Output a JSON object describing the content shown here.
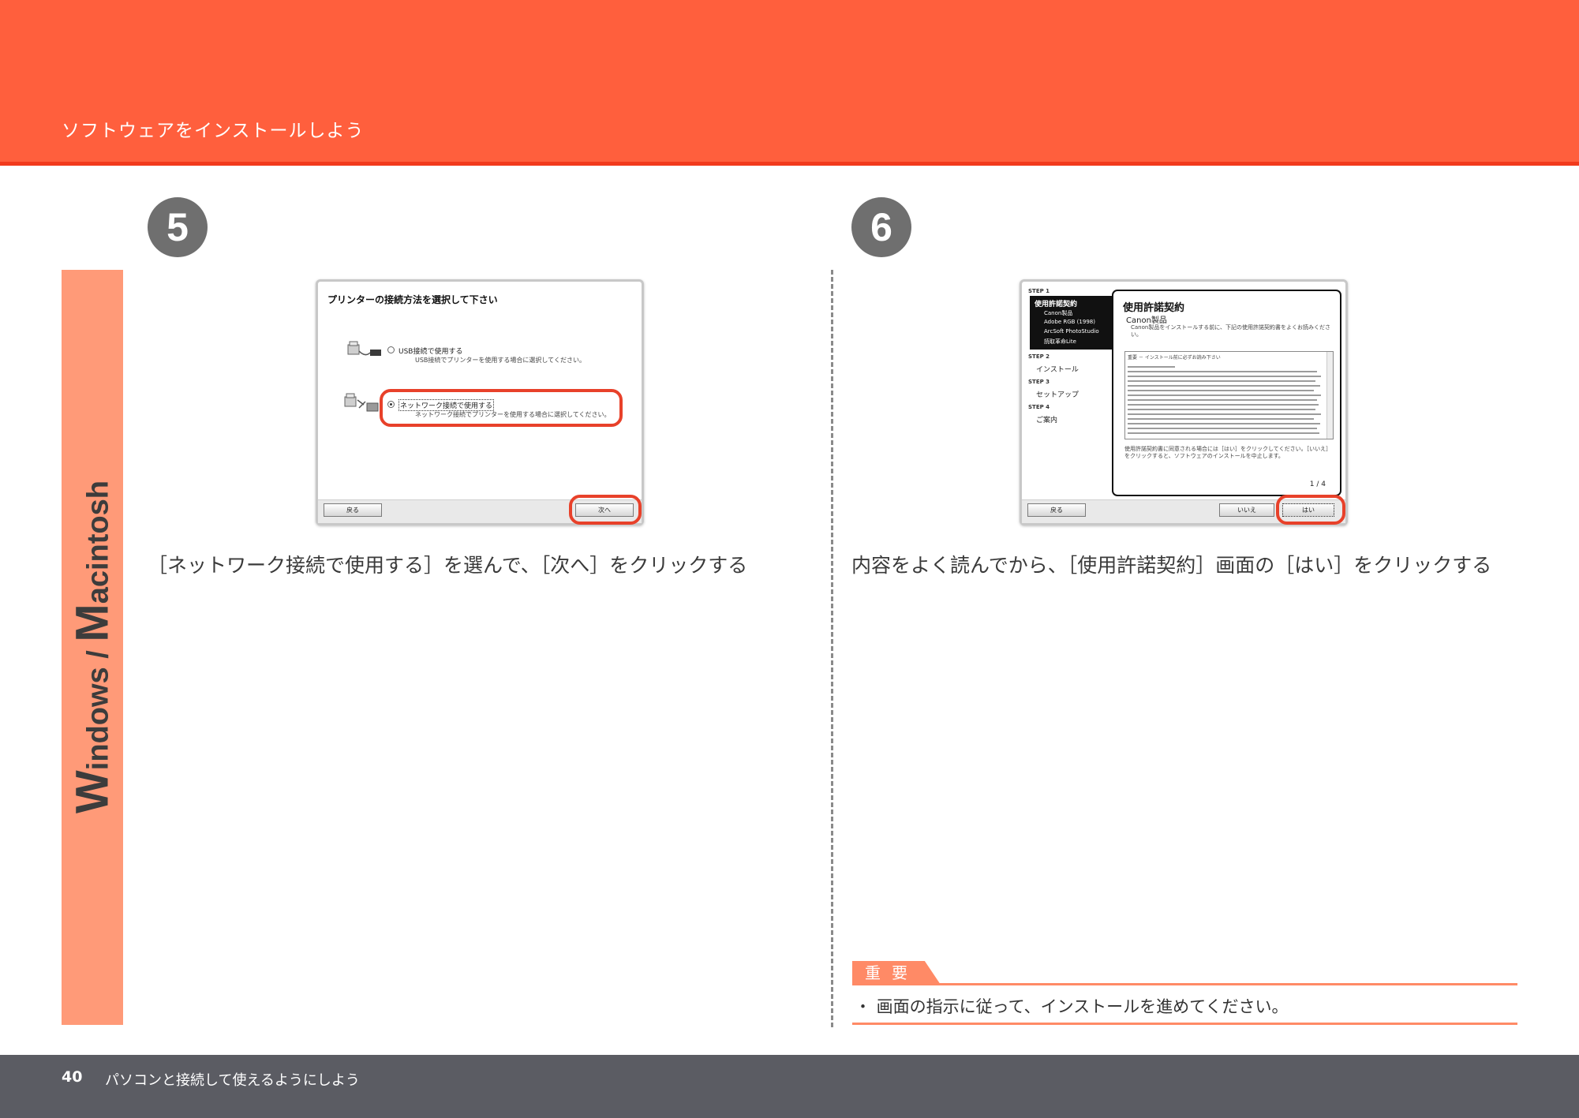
{
  "header": {
    "title": "ソフトウェアをインストールしよう"
  },
  "side_tab": {
    "label_w": "W",
    "label_indows": "indows / ",
    "label_m": "M",
    "label_acintosh": "acintosh"
  },
  "step5": {
    "number": "5",
    "dialog": {
      "title": "プリンターの接続方法を選択して下さい",
      "option_usb": "USB接続で使用する",
      "option_usb_desc": "USB接続でプリンターを使用する場合に選択してください。",
      "option_network": "ネットワーク接続で使用する",
      "option_network_desc": "ネットワーク接続でプリンターを使用する場合に選択してください。",
      "back_button": "戻る",
      "next_button": "次へ"
    },
    "caption": "［ネットワーク接続で使用する］を選んで、［次へ］をクリックする"
  },
  "step6": {
    "number": "6",
    "dialog": {
      "step1_label": "STEP 1",
      "step1_item": "使用許諾契約",
      "step1_sub1": "Canon製品",
      "step1_sub2": "Adobe RGB (1998)",
      "step1_sub3": "ArcSoft PhotoStudio",
      "step1_sub4": "読取革命Lite",
      "step2_label": "STEP 2",
      "step2_item": "インストール",
      "step3_label": "STEP 3",
      "step3_item": "セットアップ",
      "step4_label": "STEP 4",
      "step4_item": "ご案内",
      "panel_title": "使用許諾契約",
      "panel_subtitle": "Canon製品",
      "panel_intro": "Canon製品をインストールする前に、下記の使用許諾契約書をよくお読みください。",
      "textarea_head": "重要 － インストール前に必ずお読み下さい",
      "panel_question": "使用許諾契約書に同意される場合には［はい］をクリックしてください。［いいえ］をクリックすると、ソフトウェアのインストールを中止します。",
      "page_indicator": "1 / 4",
      "back_button": "戻る",
      "no_button": "いいえ",
      "yes_button": "はい"
    },
    "caption": "内容をよく読んでから、［使用許諾契約］画面の［はい］をクリックする"
  },
  "important": {
    "label": "重要",
    "text": "・ 画面の指示に従って、インストールを進めてください。"
  },
  "footer": {
    "page_number": "40",
    "text": "パソコンと接続して使えるようにしよう"
  },
  "colors": {
    "header": "#ff5f3d",
    "side_tab": "#ff9a78",
    "highlight": "#e8412a",
    "footer": "#5b5c63"
  }
}
